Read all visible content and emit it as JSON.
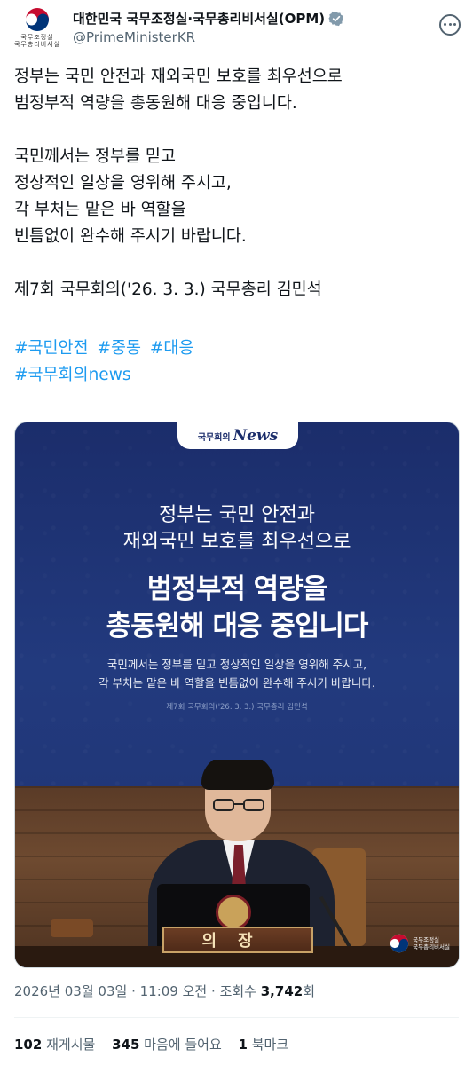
{
  "header": {
    "logo_text": [
      "국무조정실",
      "국무총리비서실"
    ],
    "display_name": "대한민국 국무조정실·국무총리비서실(OPM)",
    "handle": "@PrimeMinisterKR",
    "verified": true
  },
  "tweet": {
    "paragraphs": [
      [
        "정부는 국민 안전과 재외국민 보호를 최우선으로",
        "범정부적 역량을 총동원해 대응 중입니다."
      ],
      [
        "국민께서는 정부를 믿고",
        "정상적인 일상을 영위해 주시고,",
        "각 부처는 맡은 바 역할을",
        "빈틈없이 완수해 주시기 바랍니다."
      ],
      [
        "제7회 국무회의('26. 3. 3.) 국무총리 김민석"
      ]
    ],
    "hashtags_line1": [
      "#국민안전",
      "#중동",
      "#대응"
    ],
    "hashtags_line2": [
      "#국무회의news"
    ]
  },
  "media": {
    "badge_prefix": "국무회의",
    "badge_news": "News",
    "line1": "정부는 국민 안전과",
    "line2": "재외국민 보호를 최우선으로",
    "big1": "범정부적 역량을",
    "big2": "총동원해 대응 중입니다",
    "sub1": "국민께서는 정부를 믿고 정상적인 일상을 영위해 주시고,",
    "sub2": "각 부처는 맡은 바 역할을 빈틈없이 완수해 주시기 바랍니다.",
    "cite": "제7회 국무회의('26. 3. 3.) 국무총리 김민석",
    "nameplate": "의장",
    "logo_text": [
      "국무조정실",
      "국무총리비서실"
    ]
  },
  "meta": {
    "date": "2026년 03월 03일",
    "time": "11:09 오전",
    "views_label": "조회수",
    "views": "3,742",
    "views_suffix": "회"
  },
  "stats": {
    "retweets": "102",
    "retweets_label": "재게시물",
    "likes": "345",
    "likes_label": "마음에 들어요",
    "bookmarks": "1",
    "bookmarks_label": "북마크"
  },
  "colors": {
    "link": "#1d9bf0",
    "verified": "#829aab",
    "card_navy": "#1b2d6b"
  }
}
